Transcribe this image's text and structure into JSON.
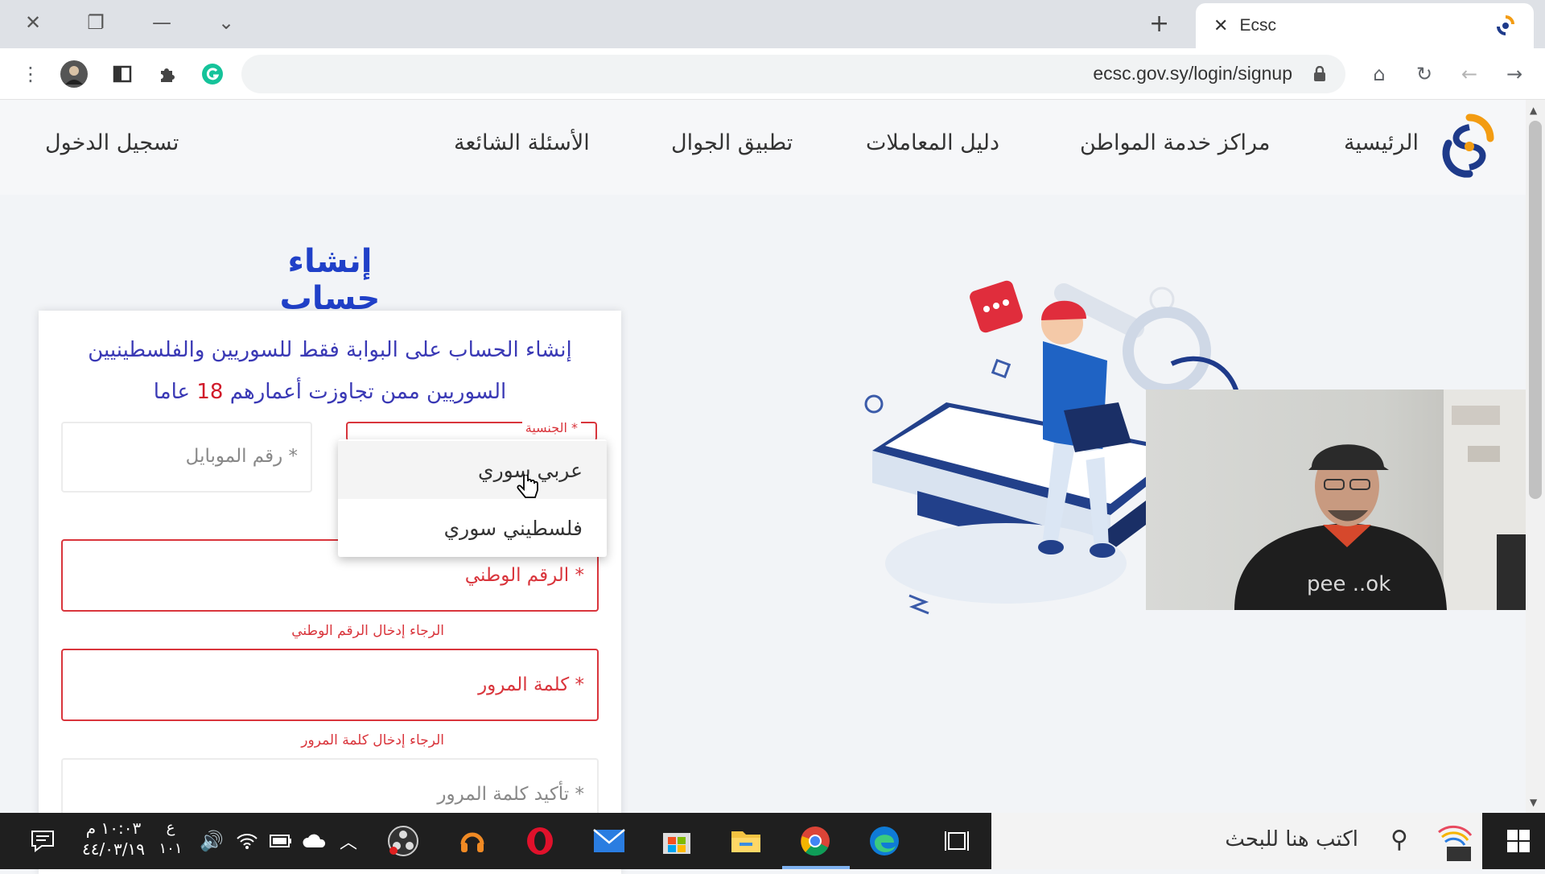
{
  "browser": {
    "tab_title": "Ecsc",
    "url": "ecsc.gov.sy/login/signup"
  },
  "site": {
    "nav": {
      "home": "الرئيسية",
      "centers": "مراكز خدمة المواطن",
      "guide": "دليل المعاملات",
      "app": "تطبيق الجوال",
      "faq": "الأسئلة الشائعة",
      "login": "تسجيل الدخول"
    },
    "page_title": "إنشاء حساب"
  },
  "form": {
    "notice_line1": "إنشاء الحساب على البوابة فقط للسوريين والفلسطينيين",
    "notice_line2_a": "السوريين ممن تجاوزت أعمارهم",
    "notice_age": "18",
    "notice_line2_b": "عاما",
    "nationality_label": "الجنسية *",
    "mobile_placeholder": "رقم الموبايل *",
    "national_id_placeholder": "الرقم الوطني *",
    "national_id_error": "الرجاء إدخال الرقم الوطني",
    "password_placeholder": "كلمة المرور *",
    "password_error": "الرجاء إدخال كلمة المرور",
    "confirm_placeholder": "تأكيد كلمة المرور *",
    "nationality_options": [
      "عربي سوري",
      "فلسطيني سوري"
    ]
  },
  "taskbar": {
    "search_placeholder": "اكتب هنا للبحث",
    "time": "١٠:٠٣ م",
    "date": "٤٤/٠٣/١٩",
    "lang_top": "ع",
    "lang_bottom": "١٠١"
  },
  "colors": {
    "accent_blue": "#2040c8",
    "error_red": "#d9353c",
    "logo_orange": "#f39c12",
    "logo_navy": "#1e3a8a"
  }
}
